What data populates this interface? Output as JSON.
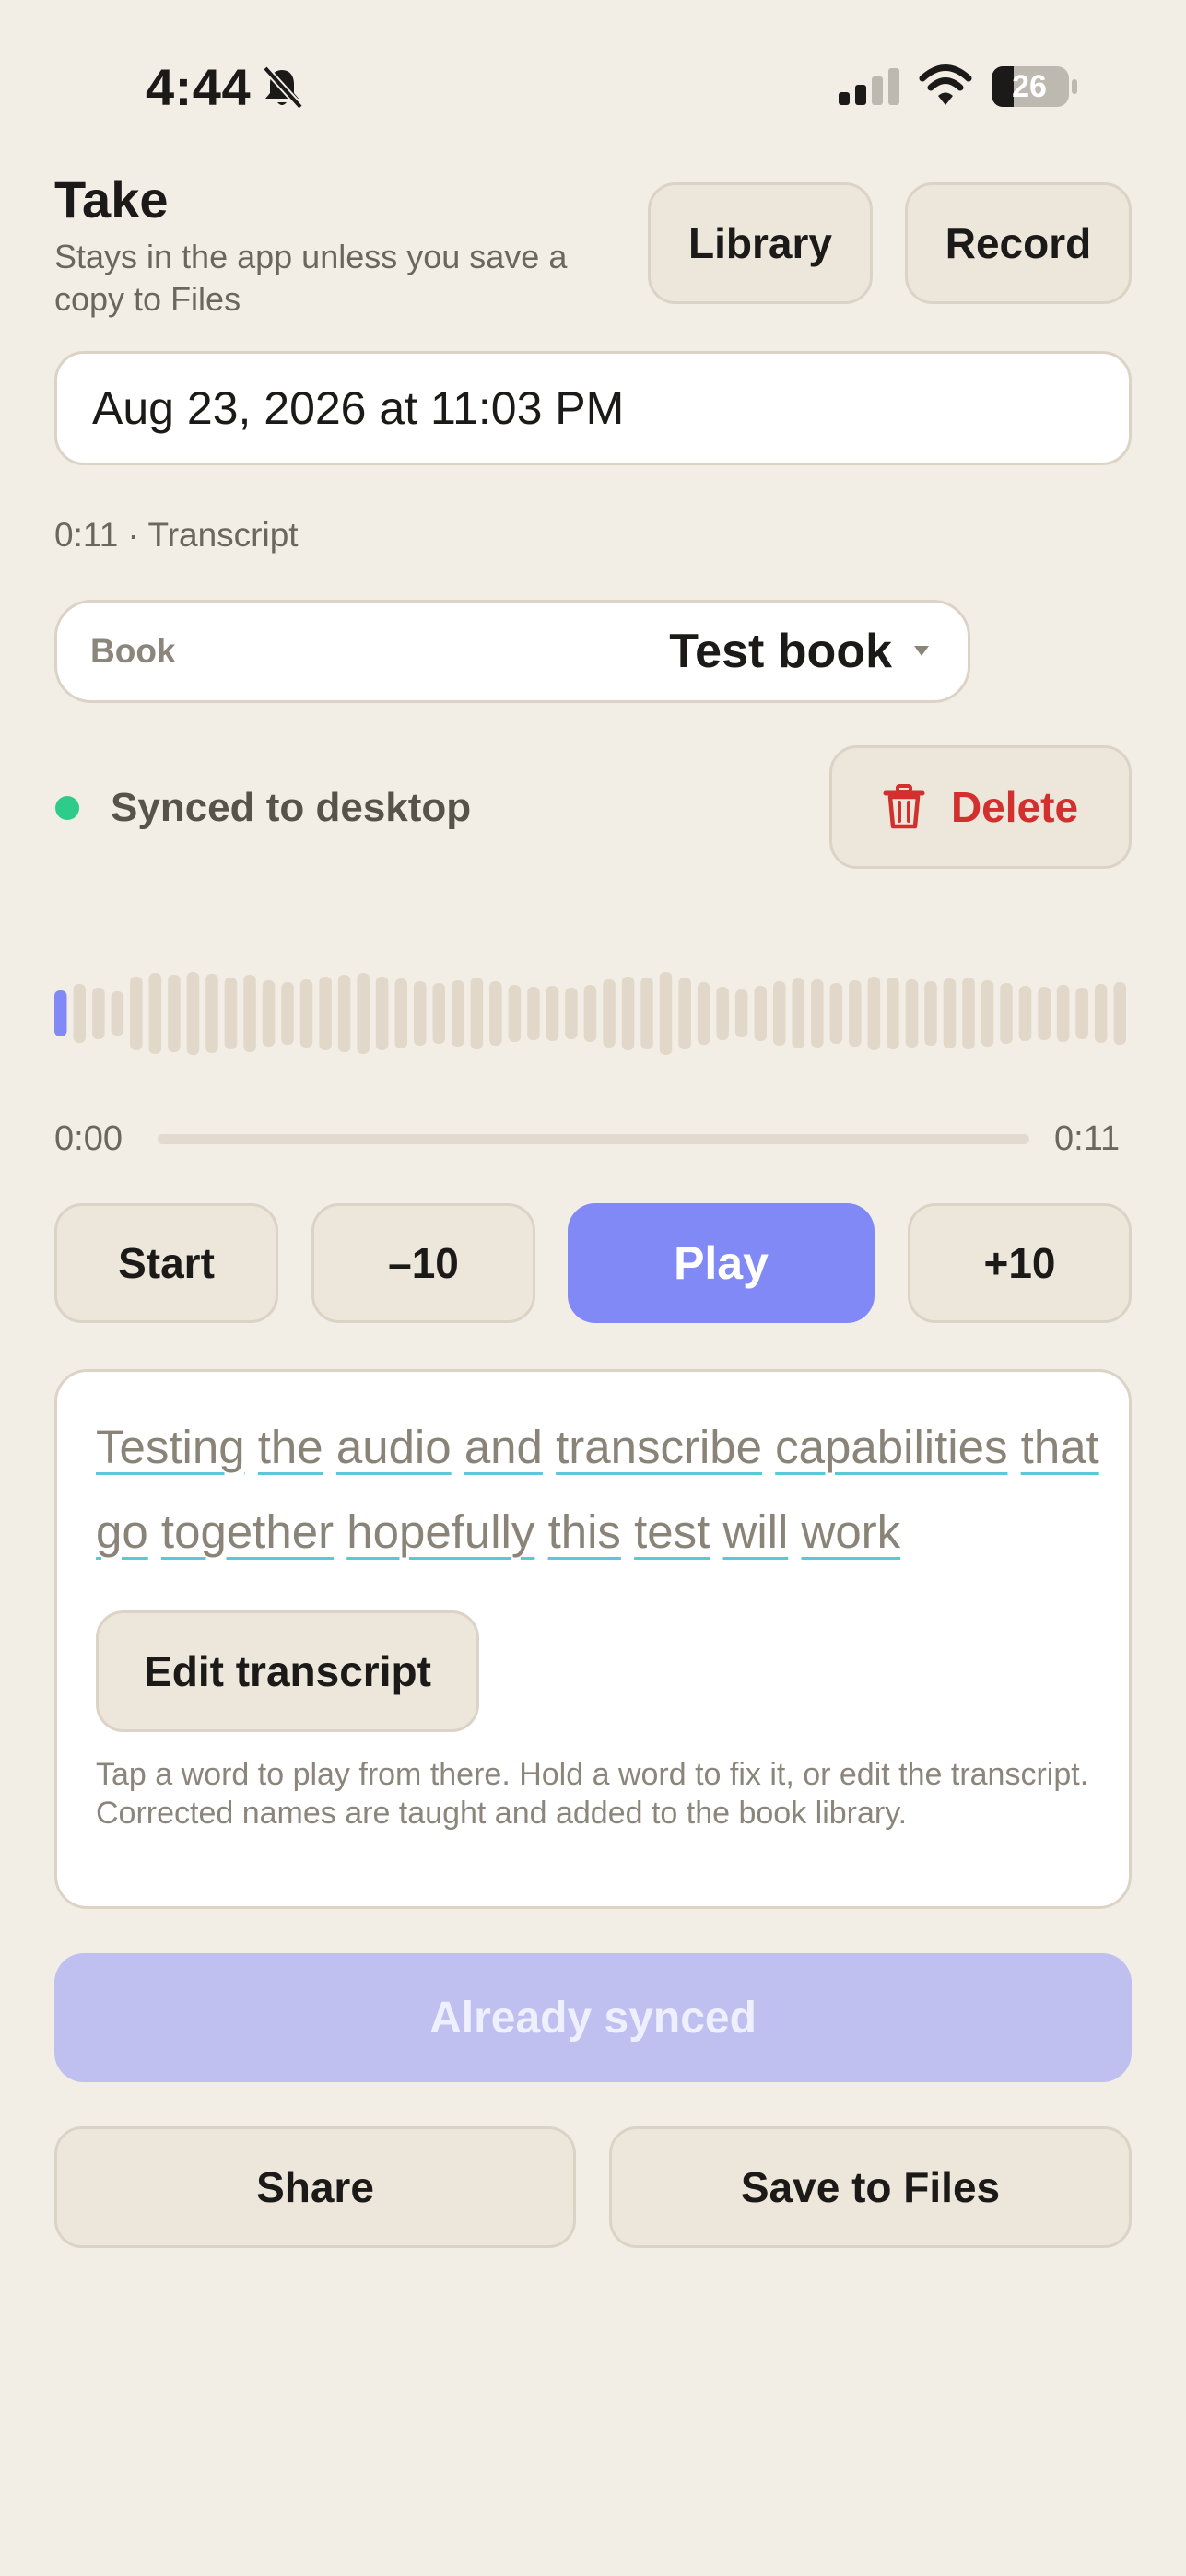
{
  "status_bar": {
    "time": "4:44",
    "battery": "26"
  },
  "header": {
    "title": "Take",
    "subtitle": "Stays in the app unless you save a copy to Files",
    "library_label": "Library",
    "record_label": "Record"
  },
  "take": {
    "title_value": "Aug 23, 2026 at 11:03 PM",
    "meta": "0:11 · Transcript"
  },
  "book": {
    "label": "Book",
    "value": "Test book"
  },
  "sync": {
    "status": "Synced to desktop",
    "delete_label": "Delete"
  },
  "player": {
    "current_time": "0:00",
    "duration": "0:11",
    "progress": 0.0,
    "start_label": "Start",
    "back_label": "–10",
    "play_label": "Play",
    "forward_label": "+10"
  },
  "transcript": {
    "words": [
      "Testing",
      "the",
      "audio",
      "and",
      "transcribe",
      "capabilities",
      "that",
      "go",
      "together",
      "hopefully",
      "this",
      "test",
      "will",
      "work"
    ],
    "edit_label": "Edit transcript",
    "hint": "Tap a word to play from there. Hold a word to fix it, or edit the transcript. Corrected names are taught and added to the book library."
  },
  "actions": {
    "synced_label": "Already synced",
    "share_label": "Share",
    "save_label": "Save to Files"
  },
  "colors": {
    "background": "#F2EDE5",
    "accent": "#8189F7",
    "accent_disabled": "#BFC0EF",
    "danger": "#D1302F",
    "synced_dot": "#2ECC8A",
    "underline": "#5CC7D9"
  }
}
